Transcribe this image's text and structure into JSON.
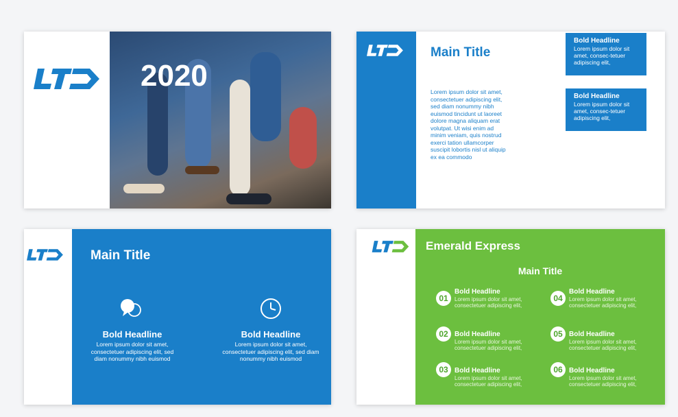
{
  "slide1": {
    "logo": "LTD",
    "year": "2020"
  },
  "slide2": {
    "logo": "LTD",
    "title": "Main Title",
    "body": "Lorem ipsum dolor sit amet, consectetuer adipiscing elit, sed diam nonummy nibh euismod tincidunt ut laoreet dolore magna aliquam erat volutpat. Ut wisi enim ad minim veniam, quis nostrud exerci tation ullamcorper suscipit lobortis nisl ut aliquip ex ea commodo",
    "box1": {
      "headline": "Bold Headline",
      "text": "Lorem ipsum dolor sit amet, consec-tetuer adipiscing elit,"
    },
    "box2": {
      "headline": "Bold Headline",
      "text": "Lorem ipsum dolor sit amet, consec-tetuer adipiscing elit,"
    }
  },
  "slide3": {
    "logo": "LTD",
    "title": "Main Title",
    "col1": {
      "icon": "chat-bubbles-icon",
      "headline": "Bold Headline",
      "text": "Lorem ipsum dolor sit amet, consectetuer adipiscing elit, sed diam nonummy nibh euismod"
    },
    "col2": {
      "icon": "clock-icon",
      "headline": "Bold Headline",
      "text": "Lorem ipsum dolor sit amet, consectetuer adipiscing elit, sed diam nonummy nibh euismod"
    }
  },
  "slide4": {
    "logo": "LTD",
    "brand": "Emerald Express",
    "title": "Main Title",
    "items": [
      {
        "num": "01",
        "headline": "Bold Headline",
        "text": "Lorem ipsum dolor sit amet, consectetuer adipiscing elit,"
      },
      {
        "num": "02",
        "headline": "Bold Headline",
        "text": "Lorem ipsum dolor sit amet, consectetuer adipiscing elit,"
      },
      {
        "num": "03",
        "headline": "Bold Headline",
        "text": "Lorem ipsum dolor sit amet, consectetuer adipiscing elit,"
      },
      {
        "num": "04",
        "headline": "Bold Headline",
        "text": "Lorem ipsum dolor sit amet, consectetuer adipiscing elit,"
      },
      {
        "num": "05",
        "headline": "Bold Headline",
        "text": "Lorem ipsum dolor sit amet, consectetuer adipiscing elit,"
      },
      {
        "num": "06",
        "headline": "Bold Headline",
        "text": "Lorem ipsum dolor sit amet, consectetuer adipiscing elit,"
      }
    ]
  },
  "colors": {
    "blue": "#1a7fc9",
    "green": "#6cbf3f",
    "white": "#ffffff"
  }
}
